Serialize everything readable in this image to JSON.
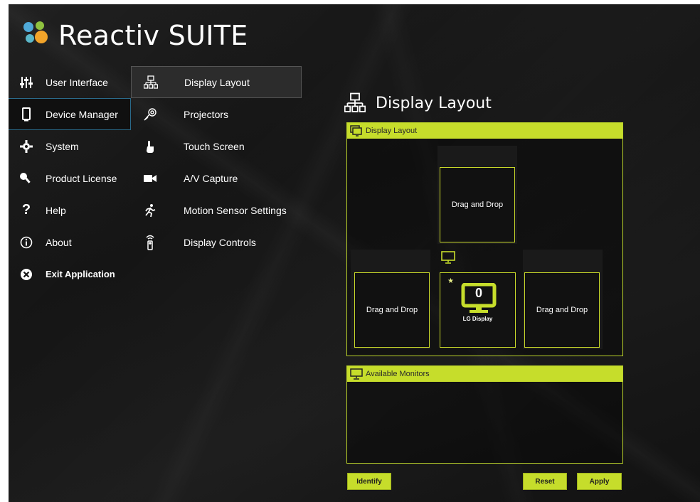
{
  "app": {
    "title": "Reactiv SUITE"
  },
  "colors": {
    "accent": "#c6dd2b",
    "background": "#181818",
    "active_nav_border": "#2a6a8a"
  },
  "nav": {
    "items": [
      {
        "label": "User Interface",
        "icon": "sliders-icon"
      },
      {
        "label": "Device Manager",
        "icon": "phone-icon",
        "active": true
      },
      {
        "label": "System",
        "icon": "gear-icon"
      },
      {
        "label": "Product License",
        "icon": "key-icon"
      },
      {
        "label": "Help",
        "icon": "question-icon"
      },
      {
        "label": "About",
        "icon": "info-icon"
      },
      {
        "label": "Exit Application",
        "icon": "close-circle-icon"
      }
    ]
  },
  "subnav": {
    "items": [
      {
        "label": "Display Layout",
        "icon": "network-icon",
        "active": true
      },
      {
        "label": "Projectors",
        "icon": "projector-icon"
      },
      {
        "label": "Touch Screen",
        "icon": "touch-icon"
      },
      {
        "label": "A/V Capture",
        "icon": "camera-icon"
      },
      {
        "label": "Motion Sensor Settings",
        "icon": "running-icon"
      },
      {
        "label": "Display Controls",
        "icon": "remote-icon"
      }
    ]
  },
  "main": {
    "title": "Display Layout",
    "layout_panel": {
      "title": "Display Layout",
      "slots": {
        "top": "Drag and Drop",
        "left": "Drag and Drop",
        "right": "Drag and Drop"
      },
      "display": {
        "number": "0",
        "name": "LG Display",
        "primary_marker": "★"
      }
    },
    "monitors_panel": {
      "title": "Available Monitors"
    },
    "buttons": {
      "identify": "Identify",
      "reset": "Reset",
      "apply": "Apply"
    }
  }
}
